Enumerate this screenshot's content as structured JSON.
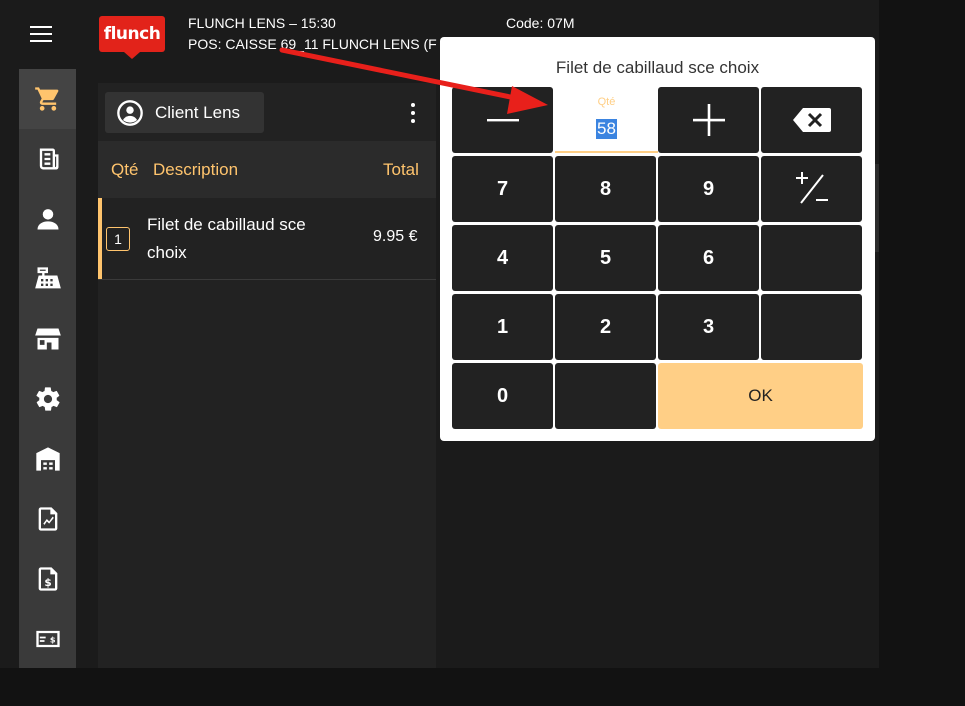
{
  "header": {
    "logo_text": "flunch",
    "line1": "FLUNCH LENS – 15:30",
    "line2": "POS: CAISSE 69_11 FLUNCH LENS (F",
    "code": "Code: 07M"
  },
  "sidebar": {
    "items": [
      {
        "icon": "cart-icon",
        "active": true
      },
      {
        "icon": "receipt-icon"
      },
      {
        "icon": "user-icon"
      },
      {
        "icon": "cash-register-icon"
      },
      {
        "icon": "store-icon"
      },
      {
        "icon": "gear-icon"
      },
      {
        "icon": "warehouse-icon"
      },
      {
        "icon": "report-chart-icon"
      },
      {
        "icon": "invoice-dollar-icon"
      },
      {
        "icon": "payment-card-icon"
      }
    ]
  },
  "order": {
    "client_label": "Client Lens",
    "columns": {
      "qty": "Qté",
      "description": "Description",
      "total": "Total"
    },
    "lines": [
      {
        "qty": "1",
        "description": "Filet de cabillaud sce choix",
        "total": "9.95 €"
      }
    ]
  },
  "dialog": {
    "title": "Filet de cabillaud sce choix",
    "qty_label": "Qté",
    "qty_value": "58",
    "keys": {
      "k7": "7",
      "k8": "8",
      "k9": "9",
      "k4": "4",
      "k5": "5",
      "k6": "6",
      "k1": "1",
      "k2": "2",
      "k3": "3",
      "k0": "0",
      "ok": "OK"
    }
  },
  "colors": {
    "accent": "#ffc46d",
    "brand": "#e2231a",
    "arrow": "#e8201b",
    "selection": "#3b84e0"
  }
}
